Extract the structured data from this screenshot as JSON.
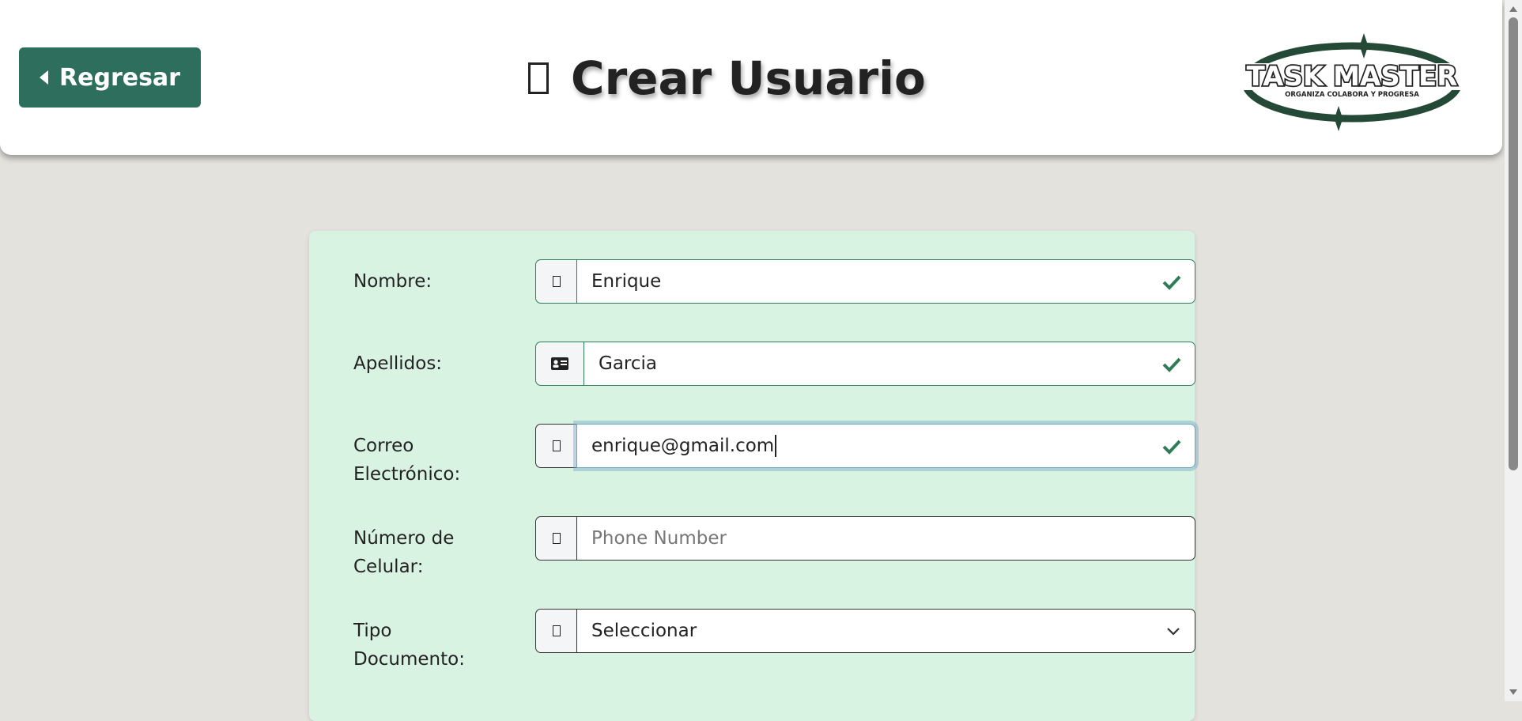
{
  "header": {
    "back_label": "Regresar",
    "title": "Crear Usuario",
    "logo_text": "TASK MASTER",
    "logo_tagline": "ORGANIZA COLABORA Y PROGRESA"
  },
  "form": {
    "nombre": {
      "label": "Nombre:",
      "value": "Enrique",
      "icon": "user-icon"
    },
    "apellidos": {
      "label": "Apellidos:",
      "value": "Garcia",
      "icon": "id-card-icon"
    },
    "correo": {
      "label_line1": "Correo",
      "label_line2": "Electrónico:",
      "value": "enrique@gmail.com",
      "icon": "envelope-icon"
    },
    "celular": {
      "label_line1": "Número de",
      "label_line2": "Celular:",
      "placeholder": "Phone Number",
      "icon": "phone-icon"
    },
    "tipo_documento": {
      "label_line1": "Tipo",
      "label_line2": "Documento:",
      "selected": "Seleccionar",
      "icon": "document-icon"
    }
  },
  "colors": {
    "accent": "#2e6e5d",
    "card_bg": "#d9f3e3",
    "valid": "#2f7d58",
    "page_bg": "#e3e2dd"
  }
}
